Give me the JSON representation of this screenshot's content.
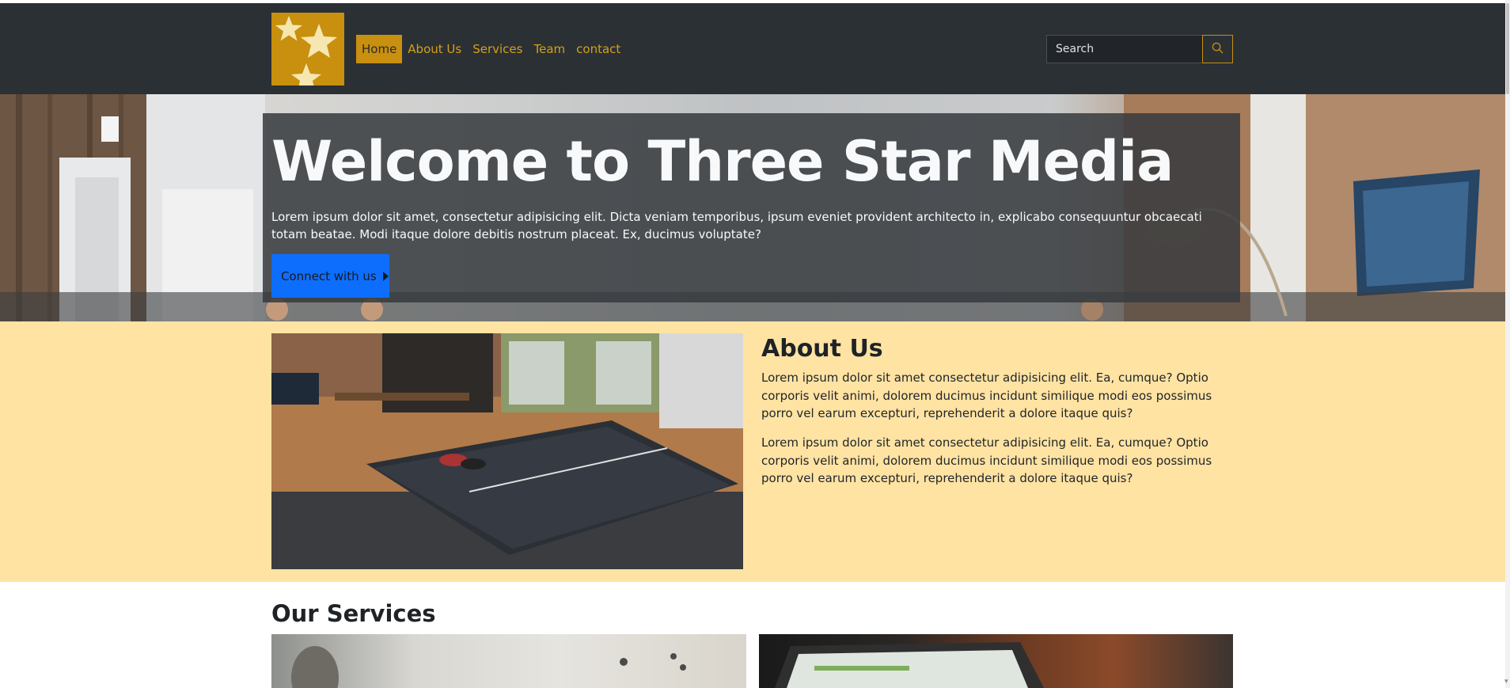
{
  "nav": {
    "links": [
      "Home",
      "About Us",
      "Services",
      "Team",
      "contact"
    ],
    "active": "Home",
    "search": {
      "placeholder": "Search",
      "value": ""
    }
  },
  "hero": {
    "title": "Welcome to Three Star Media",
    "text": "Lorem ipsum dolor sit amet, consectetur adipisicing elit. Dicta veniam temporibus, ipsum eveniet provident architecto in, explicabo consequuntur obcaecati totam beatae. Modi itaque dolore debitis nostrum placeat. Ex, ducimus voluptate?",
    "button_label": "Connect with us"
  },
  "about": {
    "title": "About Us",
    "paragraphs": [
      "Lorem ipsum dolor sit amet consectetur adipisicing elit. Ea, cumque? Optio corporis velit animi, dolorem ducimus incidunt similique modi eos possimus porro vel earum excepturi, reprehenderit a dolore itaque quis?",
      "Lorem ipsum dolor sit amet consectetur adipisicing elit. Ea, cumque? Optio corporis velit animi, dolorem ducimus incidunt similique modi eos possimus porro vel earum excepturi, reprehenderit a dolore itaque quis?"
    ]
  },
  "services": {
    "title": "Our Services"
  },
  "colors": {
    "navbar_bg": "#2b3035",
    "accent_gold": "#c8900e",
    "about_bg": "#ffe3a3",
    "button_blue": "#0d6efd"
  },
  "icons": {
    "logo": "three-stars-logo",
    "search": "search-icon",
    "button_arrow": "caret-right-icon"
  }
}
